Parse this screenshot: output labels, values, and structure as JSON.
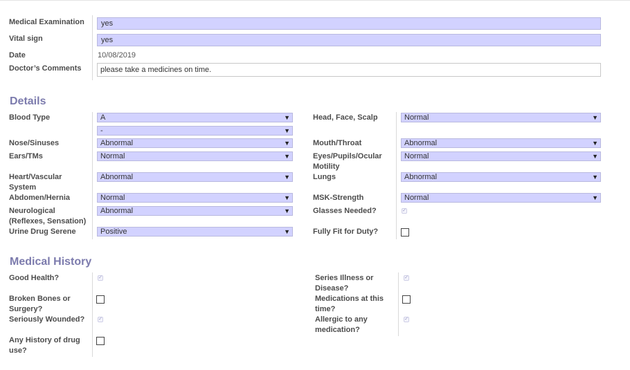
{
  "exam": {
    "medical_examination_label": "Medical Examination",
    "medical_examination_value": "yes",
    "vital_sign_label": "Vital sign",
    "vital_sign_value": "yes",
    "date_label": "Date",
    "date_value": "10/08/2019",
    "doctors_comments_label": "Doctor’s Comments",
    "doctors_comments_value": "please take a medicines on time."
  },
  "details": {
    "title": "Details",
    "blood_type_label": "Blood Type",
    "blood_type_value": "A",
    "blood_rh_value": "-",
    "head_face_scalp_label": "Head, Face, Scalp",
    "head_face_scalp_value": "Normal",
    "nose_sinuses_label": "Nose/Sinuses",
    "nose_sinuses_value": "Abnormal",
    "mouth_throat_label": "Mouth/Throat",
    "mouth_throat_value": "Abnormal",
    "ears_tms_label": "Ears/TMs",
    "ears_tms_value": "Normal",
    "eyes_label_line1": "Eyes/Pupils/Ocular",
    "eyes_label_line2": "Motility",
    "eyes_value": "Normal",
    "heart_label_line1": "Heart/Vascular",
    "heart_label_line2": "System",
    "heart_value": "Abnormal",
    "lungs_label": "Lungs",
    "lungs_value": "Abnormal",
    "abdomen_label": "Abdomen/Hernia",
    "abdomen_value": "Normal",
    "msk_label": "MSK-Strength",
    "msk_value": "Normal",
    "neuro_label_line1": "Neurological",
    "neuro_label_line2": "(Reflexes, Sensation)",
    "neuro_value": "Abnormal",
    "glasses_label": "Glasses Needed?",
    "glasses_checked": true,
    "urine_label": "Urine Drug Serene",
    "urine_value": "Positive",
    "fit_duty_label": "Fully Fit for Duty?",
    "fit_duty_checked": false
  },
  "history": {
    "title": "Medical History",
    "good_health_label": "Good Health?",
    "good_health_checked": true,
    "series_illness_label_line1": "Series Illness or",
    "series_illness_label_line2": "Disease?",
    "series_illness_checked": true,
    "broken_bones_label_line1": "Broken Bones or",
    "broken_bones_label_line2": "Surgery?",
    "broken_bones_checked": false,
    "medications_label_line1": "Medications at this",
    "medications_label_line2": "time?",
    "medications_checked": false,
    "wounded_label": "Seriously Wounded?",
    "wounded_checked": true,
    "allergic_label_line1": "Allergic to any",
    "allergic_label_line2": "medication?",
    "allergic_checked": true,
    "drug_history_label_line1": "Any History of drug",
    "drug_history_label_line2": "use?",
    "drug_history_checked": false
  },
  "icons": {
    "dropdown": "caret-down-icon",
    "checkmark": "checkmark-icon"
  },
  "colors": {
    "field_bg": "#d2d2ff",
    "section_title": "#7c7bad"
  }
}
